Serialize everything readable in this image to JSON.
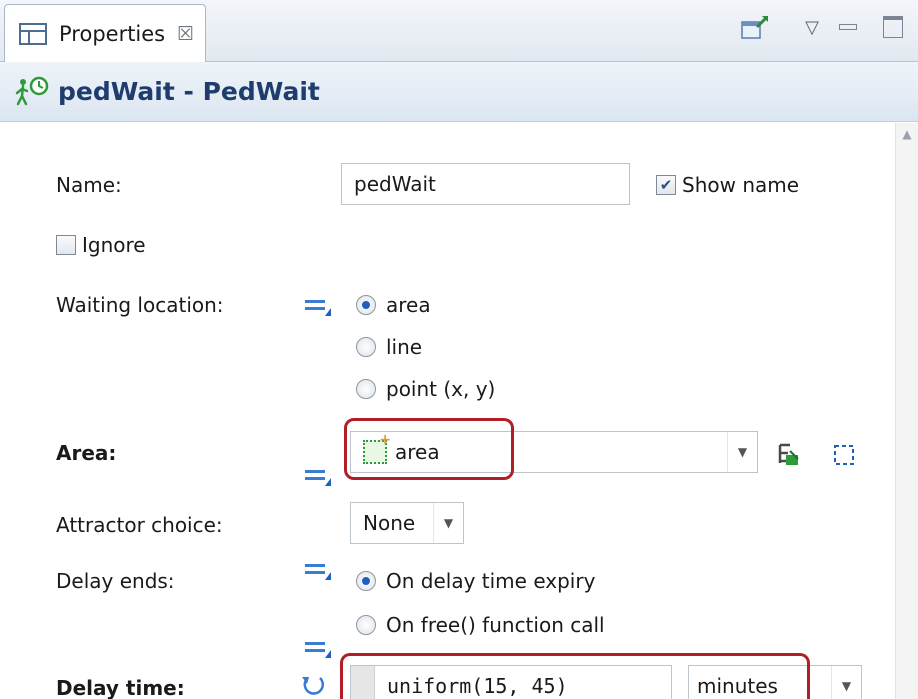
{
  "tab": {
    "label": "Properties",
    "close_glyph": "☒"
  },
  "toolbar": {
    "menu_glyph": "▽"
  },
  "header": {
    "title": "pedWait - PedWait"
  },
  "form": {
    "name_label": "Name:",
    "name_value": "pedWait",
    "show_name_label": "Show name",
    "show_name_checked": true,
    "ignore_label": "Ignore",
    "ignore_checked": false,
    "waiting_location_label": "Waiting location:",
    "waiting_options": [
      "area",
      "line",
      "point (x, y)"
    ],
    "waiting_selected": "area",
    "area_label": "Area:",
    "area_value": "area",
    "attractor_label": "Attractor choice:",
    "attractor_value": "None",
    "delay_ends_label": "Delay ends:",
    "delay_ends_options": [
      "On delay time expiry",
      "On free() function call"
    ],
    "delay_ends_selected": "On delay time expiry",
    "delay_time_label": "Delay time:",
    "delay_time_value": "uniform(15, 45)",
    "delay_time_unit": "minutes"
  },
  "colors": {
    "highlight": "#b21e26",
    "title": "#1f3c6e",
    "accent": "#3a7bd5"
  }
}
